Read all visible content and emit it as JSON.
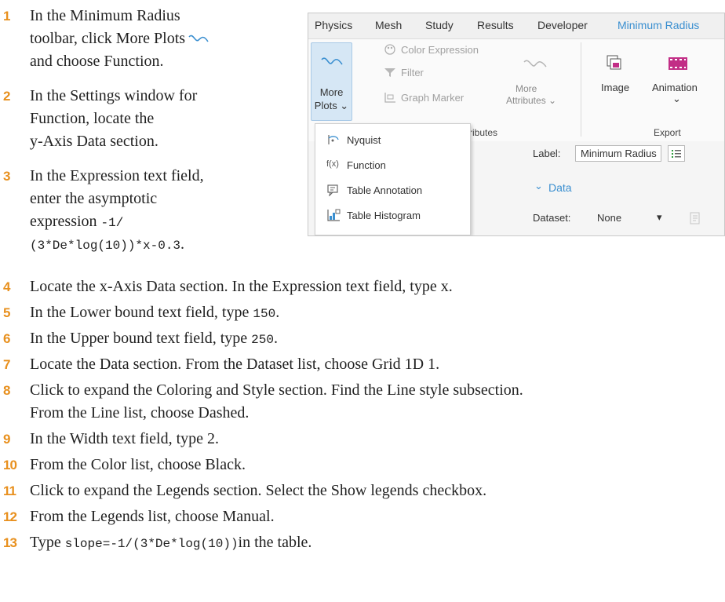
{
  "steps": [
    {
      "num": "1",
      "lines": [
        "In the Minimum Radius",
        "toolbar, click More Plots",
        "and choose Function."
      ]
    },
    {
      "num": "2",
      "lines": [
        "In the Settings window for",
        "Function, locate the",
        "y-Axis Data section."
      ]
    },
    {
      "num": "3",
      "lines": [
        "In the Expression text field,",
        "enter the asymptotic",
        "expression",
        "-1/",
        "(3*De*log(10))*x-0.3",
        "."
      ]
    },
    {
      "num": "4",
      "text": "Locate the x-Axis Data section. In the Expression text field, type x."
    },
    {
      "num": "5",
      "pre": "In the Lower bound text field, type ",
      "code": "150",
      "post": "."
    },
    {
      "num": "6",
      "pre": "In the Upper bound text field, type ",
      "code": "250",
      "post": "."
    },
    {
      "num": "7",
      "text": "Locate the Data section. From the Dataset list, choose Grid 1D 1."
    },
    {
      "num": "8",
      "lines": [
        "Click to expand the Coloring and Style section. Find the Line style subsection.",
        "From the Line list, choose Dashed."
      ]
    },
    {
      "num": "9",
      "text": "In the Width text field, type 2."
    },
    {
      "num": "10",
      "text": "From the Color list, choose Black."
    },
    {
      "num": "11",
      "text": "Click to expand the Legends section. Select the Show legends checkbox."
    },
    {
      "num": "12",
      "text": "From the Legends list, choose Manual."
    },
    {
      "num": "13",
      "pre": "Type ",
      "code": "slope=-1/(3*De*log(10))",
      "post": "in the table."
    }
  ],
  "screenshot": {
    "menus": [
      "Physics",
      "Mesh",
      "Study",
      "Results",
      "Developer",
      "Minimum Radius"
    ],
    "more_plots": [
      "More",
      "Plots ⌄"
    ],
    "color_expression": "Color Expression",
    "filter": "Filter",
    "graph_marker": "Graph Marker",
    "more_attributes": [
      "More",
      "Attributes ⌄"
    ],
    "attributes_group_label": "ributes",
    "image": "Image",
    "animation": "Animation",
    "animation_chevron": "⌄",
    "export_group": "Export",
    "dropdown_items": [
      "Nyquist",
      "Function",
      "Table Annotation",
      "Table Histogram"
    ],
    "function_icon_text": "f(x)",
    "label_caption": "Label:",
    "label_value": "Minimum Radius",
    "data_section": "Data",
    "data_chevron": "⌄",
    "dataset_caption": "Dataset:",
    "dataset_value": "None",
    "dataset_arrow": "▾"
  },
  "colors": {
    "step_number": "#e8901e",
    "accent": "#3a8fd0",
    "button_bg": "#d6e7f5"
  }
}
